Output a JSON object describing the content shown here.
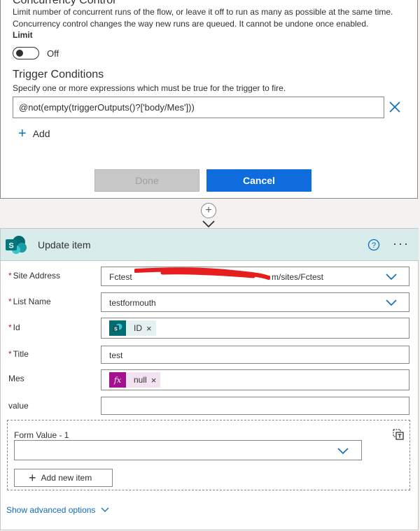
{
  "settings": {
    "concurrency_title": "Concurrency Control",
    "concurrency_desc": "Limit number of concurrent runs of the flow, or leave it off to run as many as possible at the same time. Concurrency control changes the way new runs are queued. It cannot be undone once enabled.",
    "limit_label": "Limit",
    "limit_state": "Off",
    "trigger_title": "Trigger Conditions",
    "trigger_desc": "Specify one or more expressions which must be true for the trigger to fire.",
    "condition_value": "@not(empty(triggerOutputs()?['body/Mes']))",
    "add_label": "Add",
    "done_label": "Done",
    "cancel_label": "Cancel"
  },
  "action": {
    "title": "Update item",
    "fields": {
      "site_address": {
        "label": "Site Address",
        "required": "*",
        "value": "Fctest",
        "value_suffix": "m/sites/Fctest"
      },
      "list_name": {
        "label": "List Name",
        "required": "*",
        "value": "testformouth"
      },
      "id": {
        "label": "Id",
        "required": "*",
        "token": "ID",
        "remove": "×"
      },
      "title": {
        "label": "Title",
        "required": "*",
        "value": "test"
      },
      "mes": {
        "label": "Mes",
        "token": "null",
        "remove": "×"
      },
      "value": {
        "label": "value",
        "value": ""
      }
    },
    "form_value_label": "Form Value - 1",
    "add_new_item_label": "Add new item",
    "advanced_options_label": "Show advanced options",
    "more_menu": "···"
  },
  "colors": {
    "accent": "#0f6cdd",
    "header_bg": "#d9ecec",
    "sharepoint": "#036c70",
    "expression": "#a4108e",
    "required": "#a4262c"
  },
  "icons": [
    "sharepoint-icon",
    "help-icon",
    "chevron-down-icon",
    "close-icon",
    "plus-icon",
    "function-icon",
    "dynamic-content-toggle-icon",
    "arrow-down-icon"
  ]
}
